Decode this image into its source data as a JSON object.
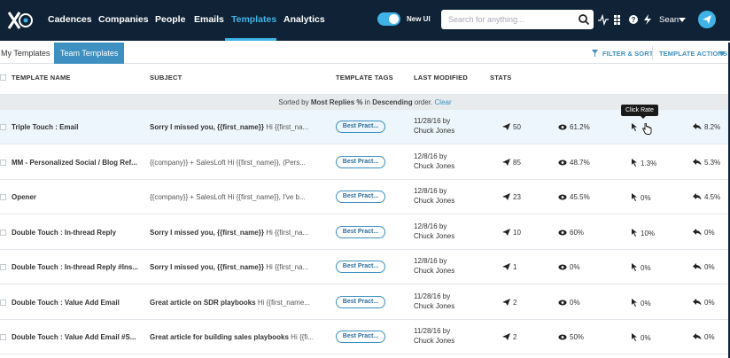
{
  "nav": {
    "items": [
      "Cadences",
      "Companies",
      "People",
      "Emails",
      "Templates",
      "Analytics"
    ],
    "active": "Templates",
    "toggle_label": "New UI",
    "search_placeholder": "Search for anything...",
    "user_name": "Sean",
    "icons": [
      "activity-icon",
      "grid-icon",
      "help-icon",
      "lightning-icon"
    ]
  },
  "subnav": {
    "tabs": [
      "My Templates",
      "Team Templates"
    ],
    "active_tab": "Team Templates",
    "filter_label": "FILTER & SORT",
    "actions_label": "TEMPLATE ACTIONS"
  },
  "table": {
    "headers": {
      "name": "TEMPLATE NAME",
      "subject": "SUBJECT",
      "tags": "TEMPLATE TAGS",
      "modified": "LAST MODIFIED",
      "stats": "STATS"
    },
    "sort": {
      "prefix": "Sorted by",
      "field": "Most Replies %",
      "middle": "in",
      "order": "Descending",
      "suffix": "order.",
      "clear": "Clear"
    },
    "tooltip": "Click Rate",
    "rows": [
      {
        "name": "Triple Touch : Email",
        "subject_bold": "Sorry I missed you, {{first_name}}",
        "subject_rest": "Hi {{first_na...",
        "tag": "Best Pract...",
        "modified_date": "11/28/16 by",
        "modified_by": "Chuck Jones",
        "sent": "50",
        "open": "61.2%",
        "click": "",
        "reply": "8.2%"
      },
      {
        "name": "MM - Personalized Social / Blog Ref...",
        "subject_bold": "",
        "subject_rest": "{{company}} + SalesLoft Hi {{first_name}}, (Pers...",
        "tag": "Best Pract...",
        "modified_date": "12/8/16 by",
        "modified_by": "Chuck Jones",
        "sent": "85",
        "open": "48.7%",
        "click": "1.3%",
        "reply": "5.3%"
      },
      {
        "name": "Opener",
        "subject_bold": "",
        "subject_rest": "{{company}} + SalesLoft Hi {{first_name}}, I've b...",
        "tag": "Best Pract...",
        "modified_date": "12/8/16 by",
        "modified_by": "Chuck Jones",
        "sent": "23",
        "open": "45.5%",
        "click": "0%",
        "reply": "4.5%"
      },
      {
        "name": "Double Touch : In-thread Reply",
        "subject_bold": "Sorry I missed you, {{first_name}}",
        "subject_rest": "Hi {{first_na...",
        "tag": "Best Pract...",
        "modified_date": "12/8/16 by",
        "modified_by": "Chuck Jones",
        "sent": "10",
        "open": "60%",
        "click": "10%",
        "reply": "0%"
      },
      {
        "name": "Double Touch : In-thread Reply #Ins...",
        "subject_bold": "Sorry I missed you, {{first_name}}",
        "subject_rest": "Hi {{first_na...",
        "tag": "Best Pract...",
        "modified_date": "12/8/16 by",
        "modified_by": "Chuck Jones",
        "sent": "1",
        "open": "0%",
        "click": "0%",
        "reply": "0%"
      },
      {
        "name": "Double Touch : Value Add Email",
        "subject_bold": "Great article on SDR playbooks",
        "subject_rest": "Hi {{first_name...",
        "tag": "Best Pract...",
        "modified_date": "11/28/16 by",
        "modified_by": "Chuck Jones",
        "sent": "2",
        "open": "0%",
        "click": "0%",
        "reply": "0%"
      },
      {
        "name": "Double Touch : Value Add Email #S...",
        "subject_bold": "Great article for building sales playbooks",
        "subject_rest": "Hi {{fi...",
        "tag": "Best Pract...",
        "modified_date": "11/28/16 by",
        "modified_by": "Chuck Jones",
        "sent": "2",
        "open": "50%",
        "click": "0%",
        "reply": "0%"
      }
    ]
  },
  "colors": {
    "nav_bg": "#0f2236",
    "accent": "#3fb3e6",
    "link": "#3d90c0",
    "highlight_row": "#edf6fc"
  }
}
